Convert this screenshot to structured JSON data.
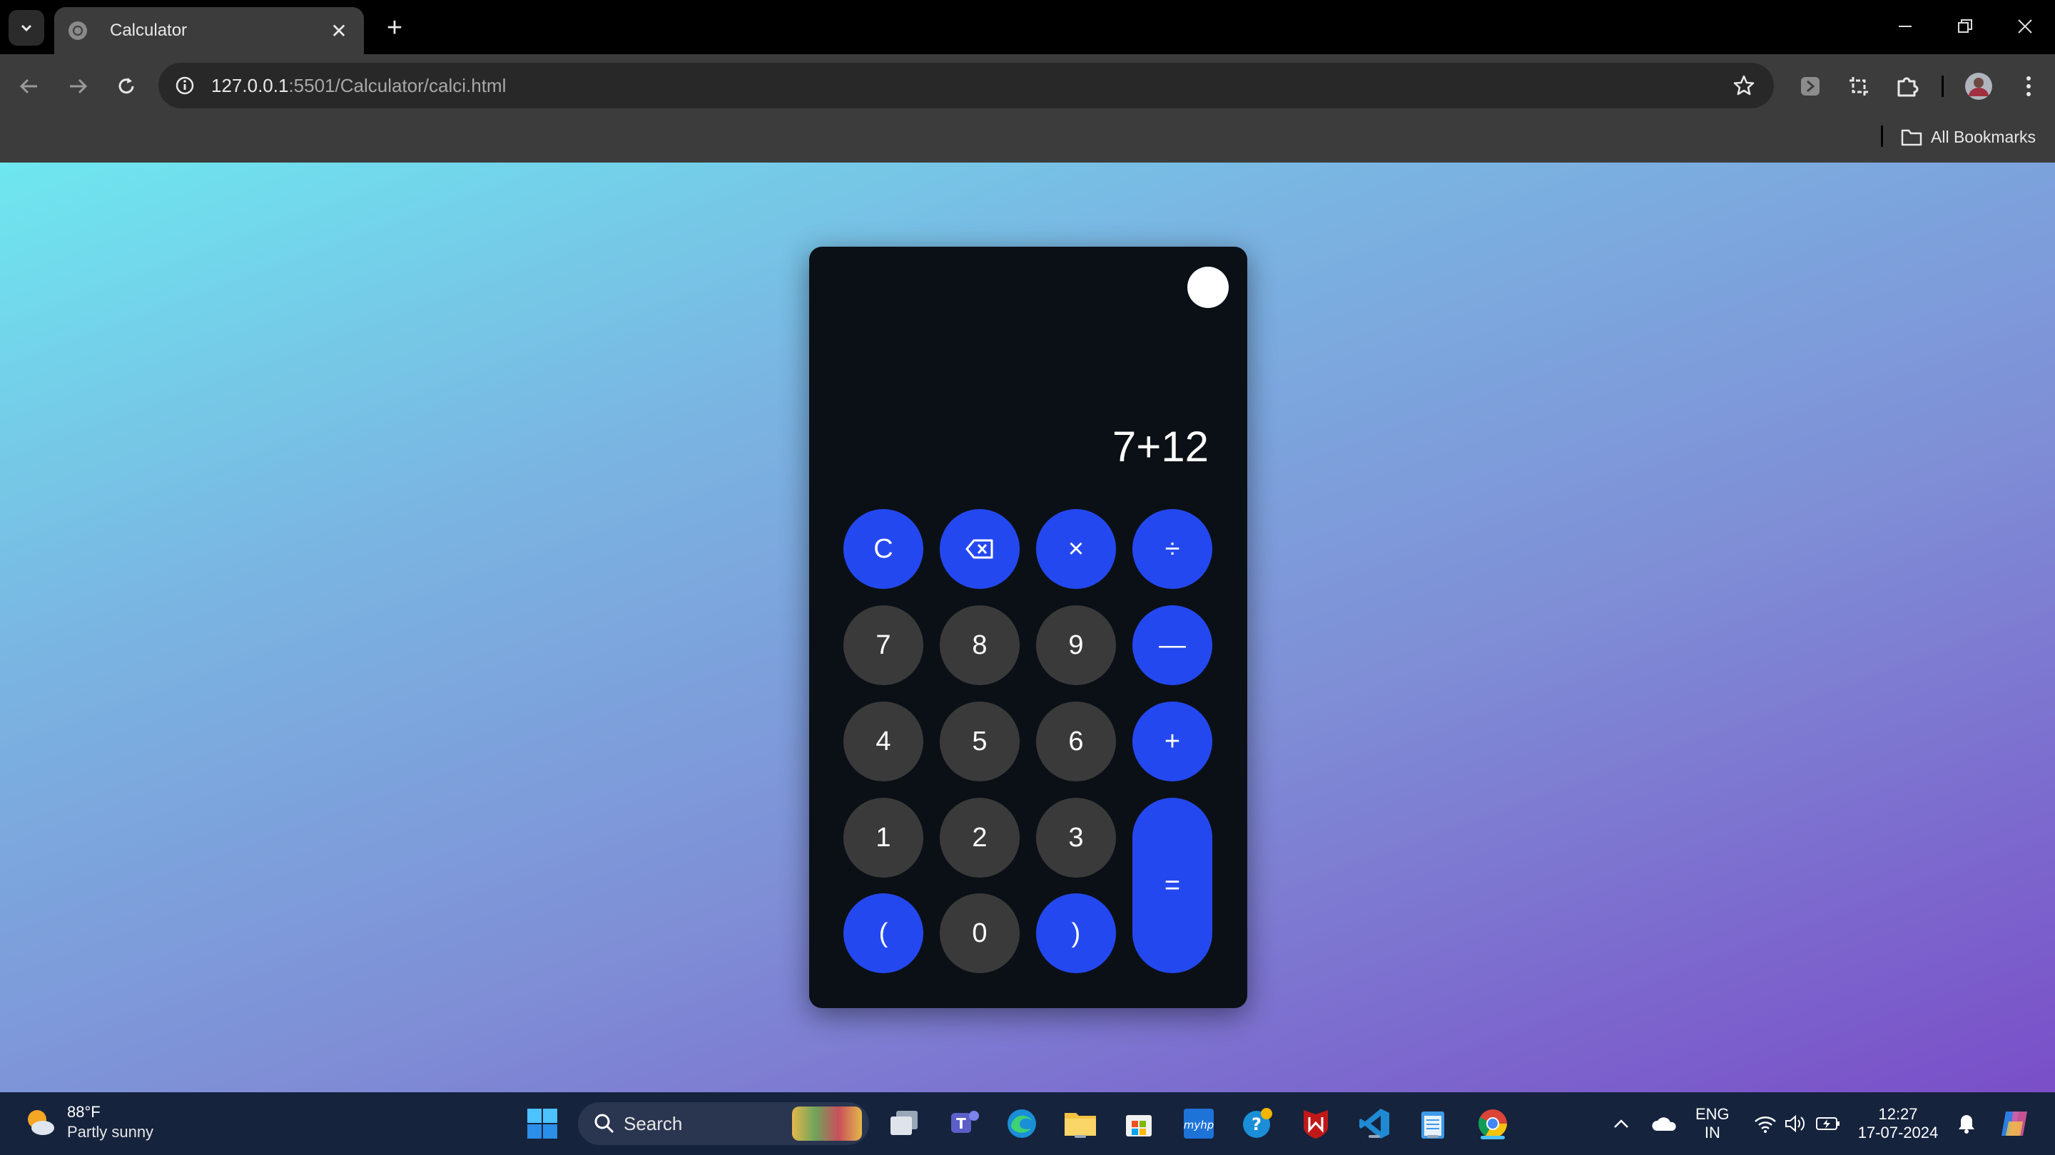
{
  "browser": {
    "tab_title": "Calculator",
    "url_host": "127.0.0.1",
    "url_rest": ":5501/Calculator/calci.html",
    "bookmarks_label": "All Bookmarks"
  },
  "calculator": {
    "display": "7+12",
    "buttons": {
      "clear": "C",
      "multiply": "×",
      "divide": "÷",
      "seven": "7",
      "eight": "8",
      "nine": "9",
      "minus": "—",
      "four": "4",
      "five": "5",
      "six": "6",
      "plus": "+",
      "one": "1",
      "two": "2",
      "three": "3",
      "equals": "=",
      "open_paren": "(",
      "zero": "0",
      "close_paren": ")"
    },
    "colors": {
      "operator": "#2448f0",
      "digit": "#3a3a3a",
      "panel": "#0b1016"
    }
  },
  "taskbar": {
    "weather_temp": "88°F",
    "weather_condition": "Partly sunny",
    "search_label": "Search",
    "language": "ENG",
    "region": "IN",
    "time": "12:27",
    "date": "17-07-2024"
  }
}
